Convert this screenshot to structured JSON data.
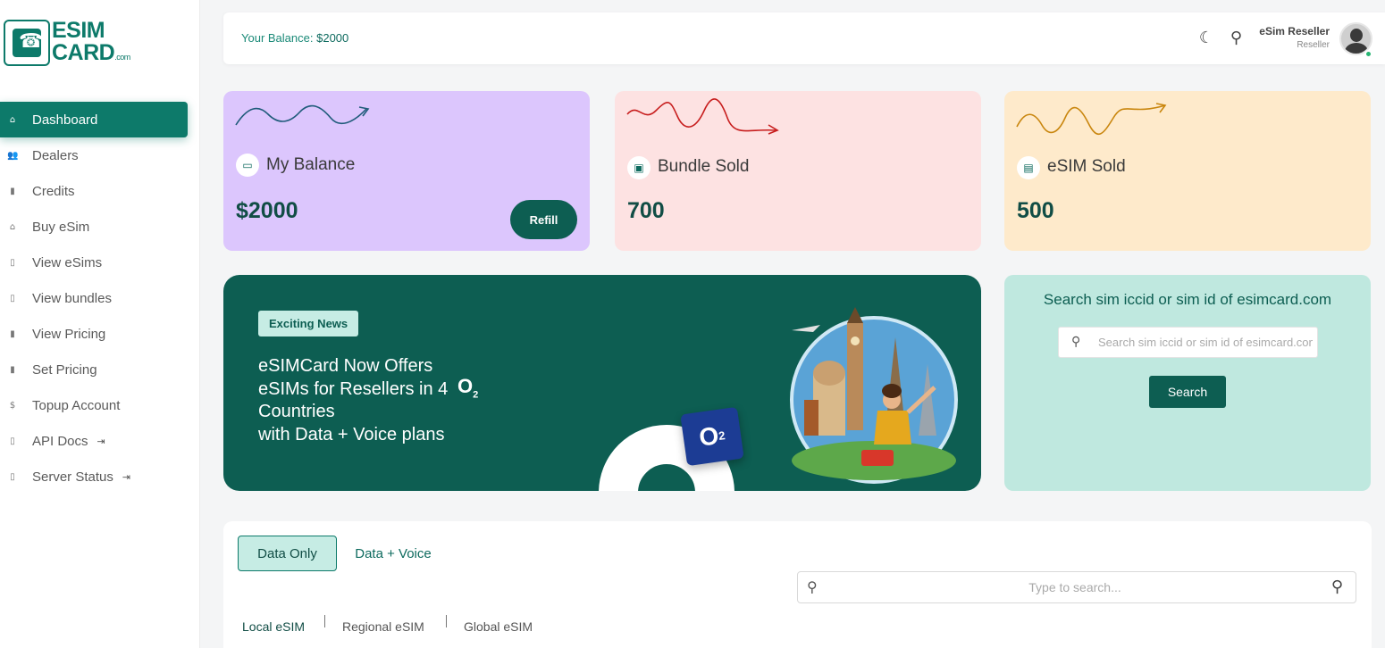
{
  "brand": {
    "line1": "ESIM",
    "line2": "CARD",
    "suffix": ".com"
  },
  "sidebar": {
    "items": [
      {
        "label": "Dashboard",
        "icon": "home-icon",
        "glyph": "⌂",
        "active": true
      },
      {
        "label": "Dealers",
        "icon": "users-icon",
        "glyph": "👥"
      },
      {
        "label": "Credits",
        "icon": "bar-chart-icon",
        "glyph": "▮"
      },
      {
        "label": "Buy eSim",
        "icon": "home-icon",
        "glyph": "⌂"
      },
      {
        "label": "View eSims",
        "icon": "file-icon",
        "glyph": "▯"
      },
      {
        "label": "View bundles",
        "icon": "file-icon",
        "glyph": "▯"
      },
      {
        "label": "View Pricing",
        "icon": "bar-chart-icon",
        "glyph": "▮"
      },
      {
        "label": "Set Pricing",
        "icon": "bar-chart-icon",
        "glyph": "▮"
      },
      {
        "label": "Topup Account",
        "icon": "dollar-icon",
        "glyph": "$"
      },
      {
        "label": "API Docs",
        "icon": "file-icon",
        "glyph": "▯",
        "external": true
      },
      {
        "label": "Server Status",
        "icon": "file-icon",
        "glyph": "▯",
        "external": true
      }
    ]
  },
  "header": {
    "balance_label": "Your Balance:",
    "balance_value": "$2000",
    "user_name": "eSim Reseller",
    "user_role": "Reseller"
  },
  "cards": {
    "balance": {
      "title": "My Balance",
      "value": "$2000",
      "button": "Refill"
    },
    "bundle": {
      "title": "Bundle Sold",
      "value": "700"
    },
    "esim": {
      "title": "eSIM Sold",
      "value": "500"
    }
  },
  "banner": {
    "badge": "Exciting News",
    "line1": "eSIMCard Now Offers",
    "line2": "eSIMs for Resellers in 4",
    "line3": "Countries",
    "line4": "with Data + Voice plans",
    "o2_letter": "O",
    "o2_sub": "2"
  },
  "search_card": {
    "title": "Search sim iccid or sim id of esimcard.com",
    "placeholder": "Search sim iccid or sim id of esimcard.com",
    "button": "Search"
  },
  "panel": {
    "tabs": [
      "Data Only",
      "Data + Voice"
    ],
    "search_placeholder": "Type to search...",
    "subtabs": [
      "Local eSIM",
      "Regional eSIM",
      "Global eSIM"
    ]
  },
  "colors": {
    "primary": "#0d5e52",
    "accent": "#0d7a6a",
    "purple": "#dcc6fd",
    "pink": "#fde2e2",
    "peach": "#feeacb",
    "mint": "#bfe8df"
  }
}
